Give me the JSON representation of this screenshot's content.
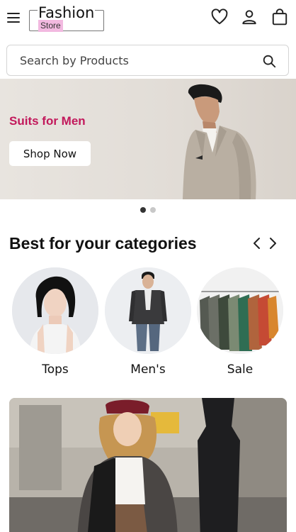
{
  "header": {
    "logo_title": "Fashion",
    "logo_subtitle": "Store",
    "icons": [
      "menu-icon",
      "heart-icon",
      "user-icon",
      "shopping-bag-icon"
    ]
  },
  "search": {
    "placeholder": "Search by Products",
    "icon": "search-icon"
  },
  "banner": {
    "title": "Suits for Men",
    "button_label": "Shop Now",
    "slide_count": 2,
    "active_slide": 1
  },
  "categories_section": {
    "title": "Best for your categories",
    "items": [
      {
        "label": "Tops"
      },
      {
        "label": "Men's"
      },
      {
        "label": "Sale"
      }
    ]
  },
  "colors": {
    "accent": "#c2185b",
    "logo_highlight": "#f2b9e0"
  }
}
